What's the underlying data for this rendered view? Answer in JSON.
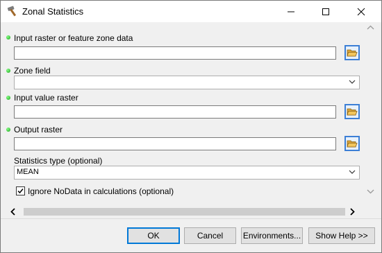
{
  "window": {
    "title": "Zonal Statistics"
  },
  "title_buttons": {
    "minimize": "—",
    "maximize": "☐",
    "close": "✕"
  },
  "form": {
    "input_zone": {
      "label": "Input raster or feature zone data",
      "value": ""
    },
    "zone_field": {
      "label": "Zone field",
      "value": ""
    },
    "input_value": {
      "label": "Input value raster",
      "value": ""
    },
    "output_raster": {
      "label": "Output raster",
      "value": ""
    },
    "statistics_type": {
      "label": "Statistics type (optional)",
      "value": "MEAN"
    },
    "ignore_nodata": {
      "label": "Ignore NoData in calculations (optional)",
      "checked": true
    }
  },
  "buttons": {
    "ok": "OK",
    "cancel": "Cancel",
    "environments": "Environments...",
    "show_help": "Show Help >>"
  },
  "colors": {
    "required_dot": "#10a010",
    "accent": "#0078d7",
    "browse_border": "#3c7fd6"
  }
}
